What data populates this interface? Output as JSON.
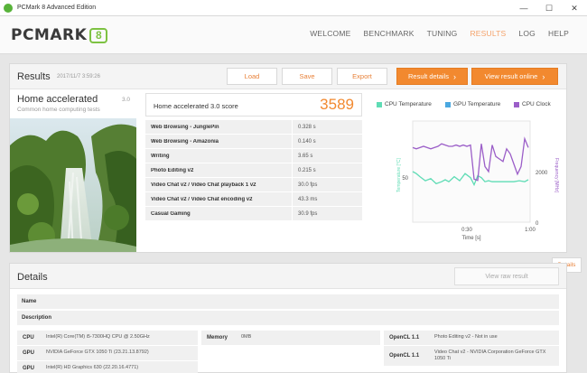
{
  "window": {
    "title": "PCMark 8 Advanced Edition",
    "controls": [
      "—",
      "☐",
      "✕"
    ]
  },
  "header": {
    "logo_text": "PCMARK",
    "logo_badge": "8",
    "nav": [
      {
        "label": "WELCOME",
        "active": false
      },
      {
        "label": "BENCHMARK",
        "active": false
      },
      {
        "label": "TUNING",
        "active": false
      },
      {
        "label": "RESULTS",
        "active": true
      },
      {
        "label": "LOG",
        "active": false
      },
      {
        "label": "HELP",
        "active": false
      }
    ]
  },
  "results": {
    "title": "Results",
    "date": "2017/11/7 3:59:26",
    "buttons": {
      "load": "Load",
      "save": "Save",
      "export": "Export",
      "result_details": "Result details",
      "view_online": "View result online"
    },
    "test": {
      "name": "Home accelerated",
      "description": "Common home computing tests",
      "version": "3.0"
    },
    "score": {
      "label": "Home accelerated 3.0 score",
      "value": "3589"
    },
    "subtests": [
      {
        "name": "Web Browsing - JunglePin",
        "value": "0.328 s"
      },
      {
        "name": "Web Browsing - Amazonia",
        "value": "0.140 s"
      },
      {
        "name": "Writing",
        "value": "3.65 s"
      },
      {
        "name": "Photo Editing v2",
        "value": "0.215 s"
      },
      {
        "name": "Video Chat v2 / Video Chat playback 1 v2",
        "value": "30.0 fps"
      },
      {
        "name": "Video Chat v2 / Video Chat encoding v2",
        "value": "43.3 ms"
      },
      {
        "name": "Casual Gaming",
        "value": "30.9 fps"
      }
    ],
    "details_button": "Details"
  },
  "chart_data": {
    "type": "line",
    "legend": [
      "CPU Temperature",
      "GPU Temperature",
      "CPU Clock"
    ],
    "colors": {
      "cpu_temp": "#5fdcb5",
      "gpu_temp": "#4aa8e0",
      "cpu_clock": "#9b5ec8"
    },
    "xlabel": "Time [s]",
    "ylabel_left": "Temperature [°C]",
    "ylabel_right": "Frequency [MHz]",
    "x_ticks": [
      "0:30",
      "1:00"
    ],
    "y_left_ticks": [
      "50"
    ],
    "y_right_ticks": [
      "2000",
      "0"
    ],
    "xlim": [
      0,
      65
    ],
    "ylim_left": [
      0,
      100
    ],
    "ylim_right": [
      0,
      4000
    ],
    "series": [
      {
        "name": "CPU Temperature",
        "axis": "left",
        "x": [
          0,
          2,
          4,
          7,
          10,
          13,
          16,
          18,
          20,
          23,
          26,
          29,
          32,
          34,
          36,
          38,
          40,
          42,
          44,
          47,
          50,
          53,
          56,
          59,
          62,
          64
        ],
        "y": [
          50,
          48,
          45,
          41,
          43,
          38,
          40,
          42,
          40,
          45,
          41,
          48,
          44,
          37,
          46,
          44,
          40,
          41,
          40,
          40,
          40,
          40,
          40,
          41,
          40,
          42
        ]
      },
      {
        "name": "CPU Clock",
        "axis": "right",
        "x": [
          0,
          2,
          4,
          6,
          8,
          10,
          12,
          14,
          16,
          18,
          20,
          22,
          24,
          26,
          28,
          30,
          32,
          34,
          36,
          38,
          40,
          42,
          44,
          46,
          48,
          50,
          52,
          54,
          56,
          58,
          60,
          62,
          64
        ],
        "y": [
          2950,
          2900,
          2950,
          3000,
          2950,
          2900,
          2950,
          3000,
          3100,
          3050,
          3000,
          3000,
          3050,
          3000,
          3050,
          3000,
          3050,
          1700,
          1650,
          3100,
          2200,
          2000,
          3050,
          2600,
          2500,
          2400,
          2900,
          2700,
          2300,
          1900,
          2200,
          3300,
          2950
        ]
      }
    ]
  },
  "details": {
    "title": "Details",
    "view_raw": "View raw result",
    "name_label": "Name",
    "description_label": "Description",
    "hardware": {
      "cpu_label": "CPU",
      "cpu_value": "Intel(R) Core(TM) i5-7300HQ CPU @ 2.50GHz",
      "gpu1_label": "GPU",
      "gpu1_value": "NVIDIA GeForce GTX 1050 Ti (23.21.13.8792)",
      "gpu2_label": "GPU",
      "gpu2_value": "Intel(R) HD Graphics 630 (22.20.16.4771)",
      "memory_label": "Memory",
      "memory_value": "0MB",
      "opencl1_label": "OpenCL 1.1",
      "opencl1_value": "Photo Editing v2 - Not in use",
      "opencl2_label": "OpenCL 1.1",
      "opencl2_value": "Video Chat v2 - NVIDIA Corporation GeForce GTX 1050 Ti"
    }
  }
}
